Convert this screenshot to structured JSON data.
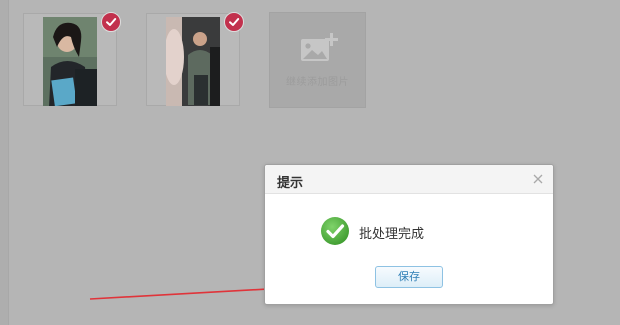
{
  "upload_area": {
    "add_more_label": "继续添加图片"
  },
  "dialog": {
    "title": "提示",
    "message": "批处理完成",
    "save_label": "保存"
  },
  "icons": {
    "selected": "check-circle-icon",
    "add_image": "add-image-icon",
    "success": "success-check-icon",
    "close": "close-icon"
  },
  "colors": {
    "overlay_gray": "#b5b5b5",
    "selected_badge": "#c2314d",
    "success_green": "#4cae3b",
    "button_blue_text": "#2f7fb6",
    "annotation_arrow": "#e0343a"
  }
}
